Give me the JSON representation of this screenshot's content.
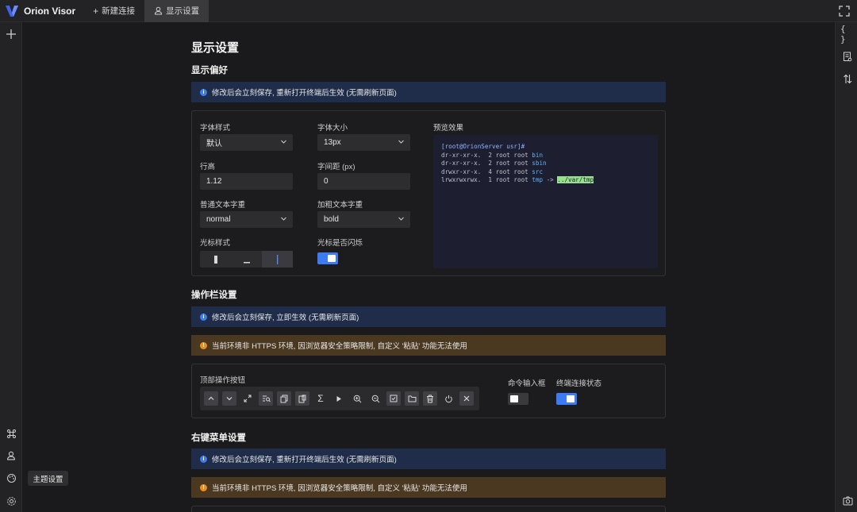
{
  "app": {
    "name": "Orion Visor"
  },
  "tabs": [
    {
      "label": "新建连接",
      "icon": "plus-icon"
    },
    {
      "label": "显示设置",
      "icon": "user-icon"
    }
  ],
  "tooltip": "主题设置",
  "page": {
    "title": "显示设置",
    "display_pref": {
      "title": "显示偏好",
      "notice": "修改后会立刻保存, 重新打开终端后生效 (无需刷新页面)",
      "font_family": {
        "label": "字体样式",
        "value": "默认"
      },
      "font_size": {
        "label": "字体大小",
        "value": "13px"
      },
      "line_height": {
        "label": "行高",
        "value": "1.12"
      },
      "letter_spacing": {
        "label": "字间距 (px)",
        "value": "0"
      },
      "font_weight": {
        "label": "普通文本字重",
        "value": "normal"
      },
      "font_weight_bold": {
        "label": "加粗文本字重",
        "value": "bold"
      },
      "cursor_style": {
        "label": "光标样式",
        "options": [
          "block",
          "underline",
          "bar"
        ],
        "selected": "bar"
      },
      "cursor_blink": {
        "label": "光标是否闪烁",
        "on": true
      },
      "preview": {
        "label": "预览效果",
        "prompt": "[root@OrionServer usr]#",
        "lines": [
          {
            "perm": "dr-xr-xr-x.  2 root root ",
            "name": "bin"
          },
          {
            "perm": "dr-xr-xr-x.  2 root root ",
            "name": "sbin"
          },
          {
            "perm": "drwxr-xr-x.  4 root root ",
            "name": "src"
          }
        ],
        "link_line": {
          "perm": "lrwxrwxrwx.  1 root root ",
          "name": "tmp",
          "arrow": " -> ",
          "target": "../var/tmp"
        }
      }
    },
    "action_bar": {
      "title": "操作栏设置",
      "notice": "修改后会立刻保存, 立即生效 (无需刷新页面)",
      "warning": "当前环境非 HTTPS 环境, 因浏览器安全策略限制, 自定义 '粘贴' 功能无法使用",
      "top_buttons_label": "顶部操作按钮",
      "command_input": {
        "label": "命令输入框",
        "on": false
      },
      "connection_status": {
        "label": "终端连接状态",
        "on": true
      }
    },
    "context_menu": {
      "title": "右键菜单设置",
      "notice": "修改后会立刻保存, 重新打开终端后生效 (无需刷新页面)",
      "warning": "当前环境非 HTTPS 环境, 因浏览器安全策略限制, 自定义 '粘贴' 功能无法使用"
    }
  },
  "colors": {
    "accent": "#3c7bf2",
    "info_bg": "#1f2d4a",
    "warn_bg": "#4a3820",
    "preview_bg": "#1d1f30"
  }
}
